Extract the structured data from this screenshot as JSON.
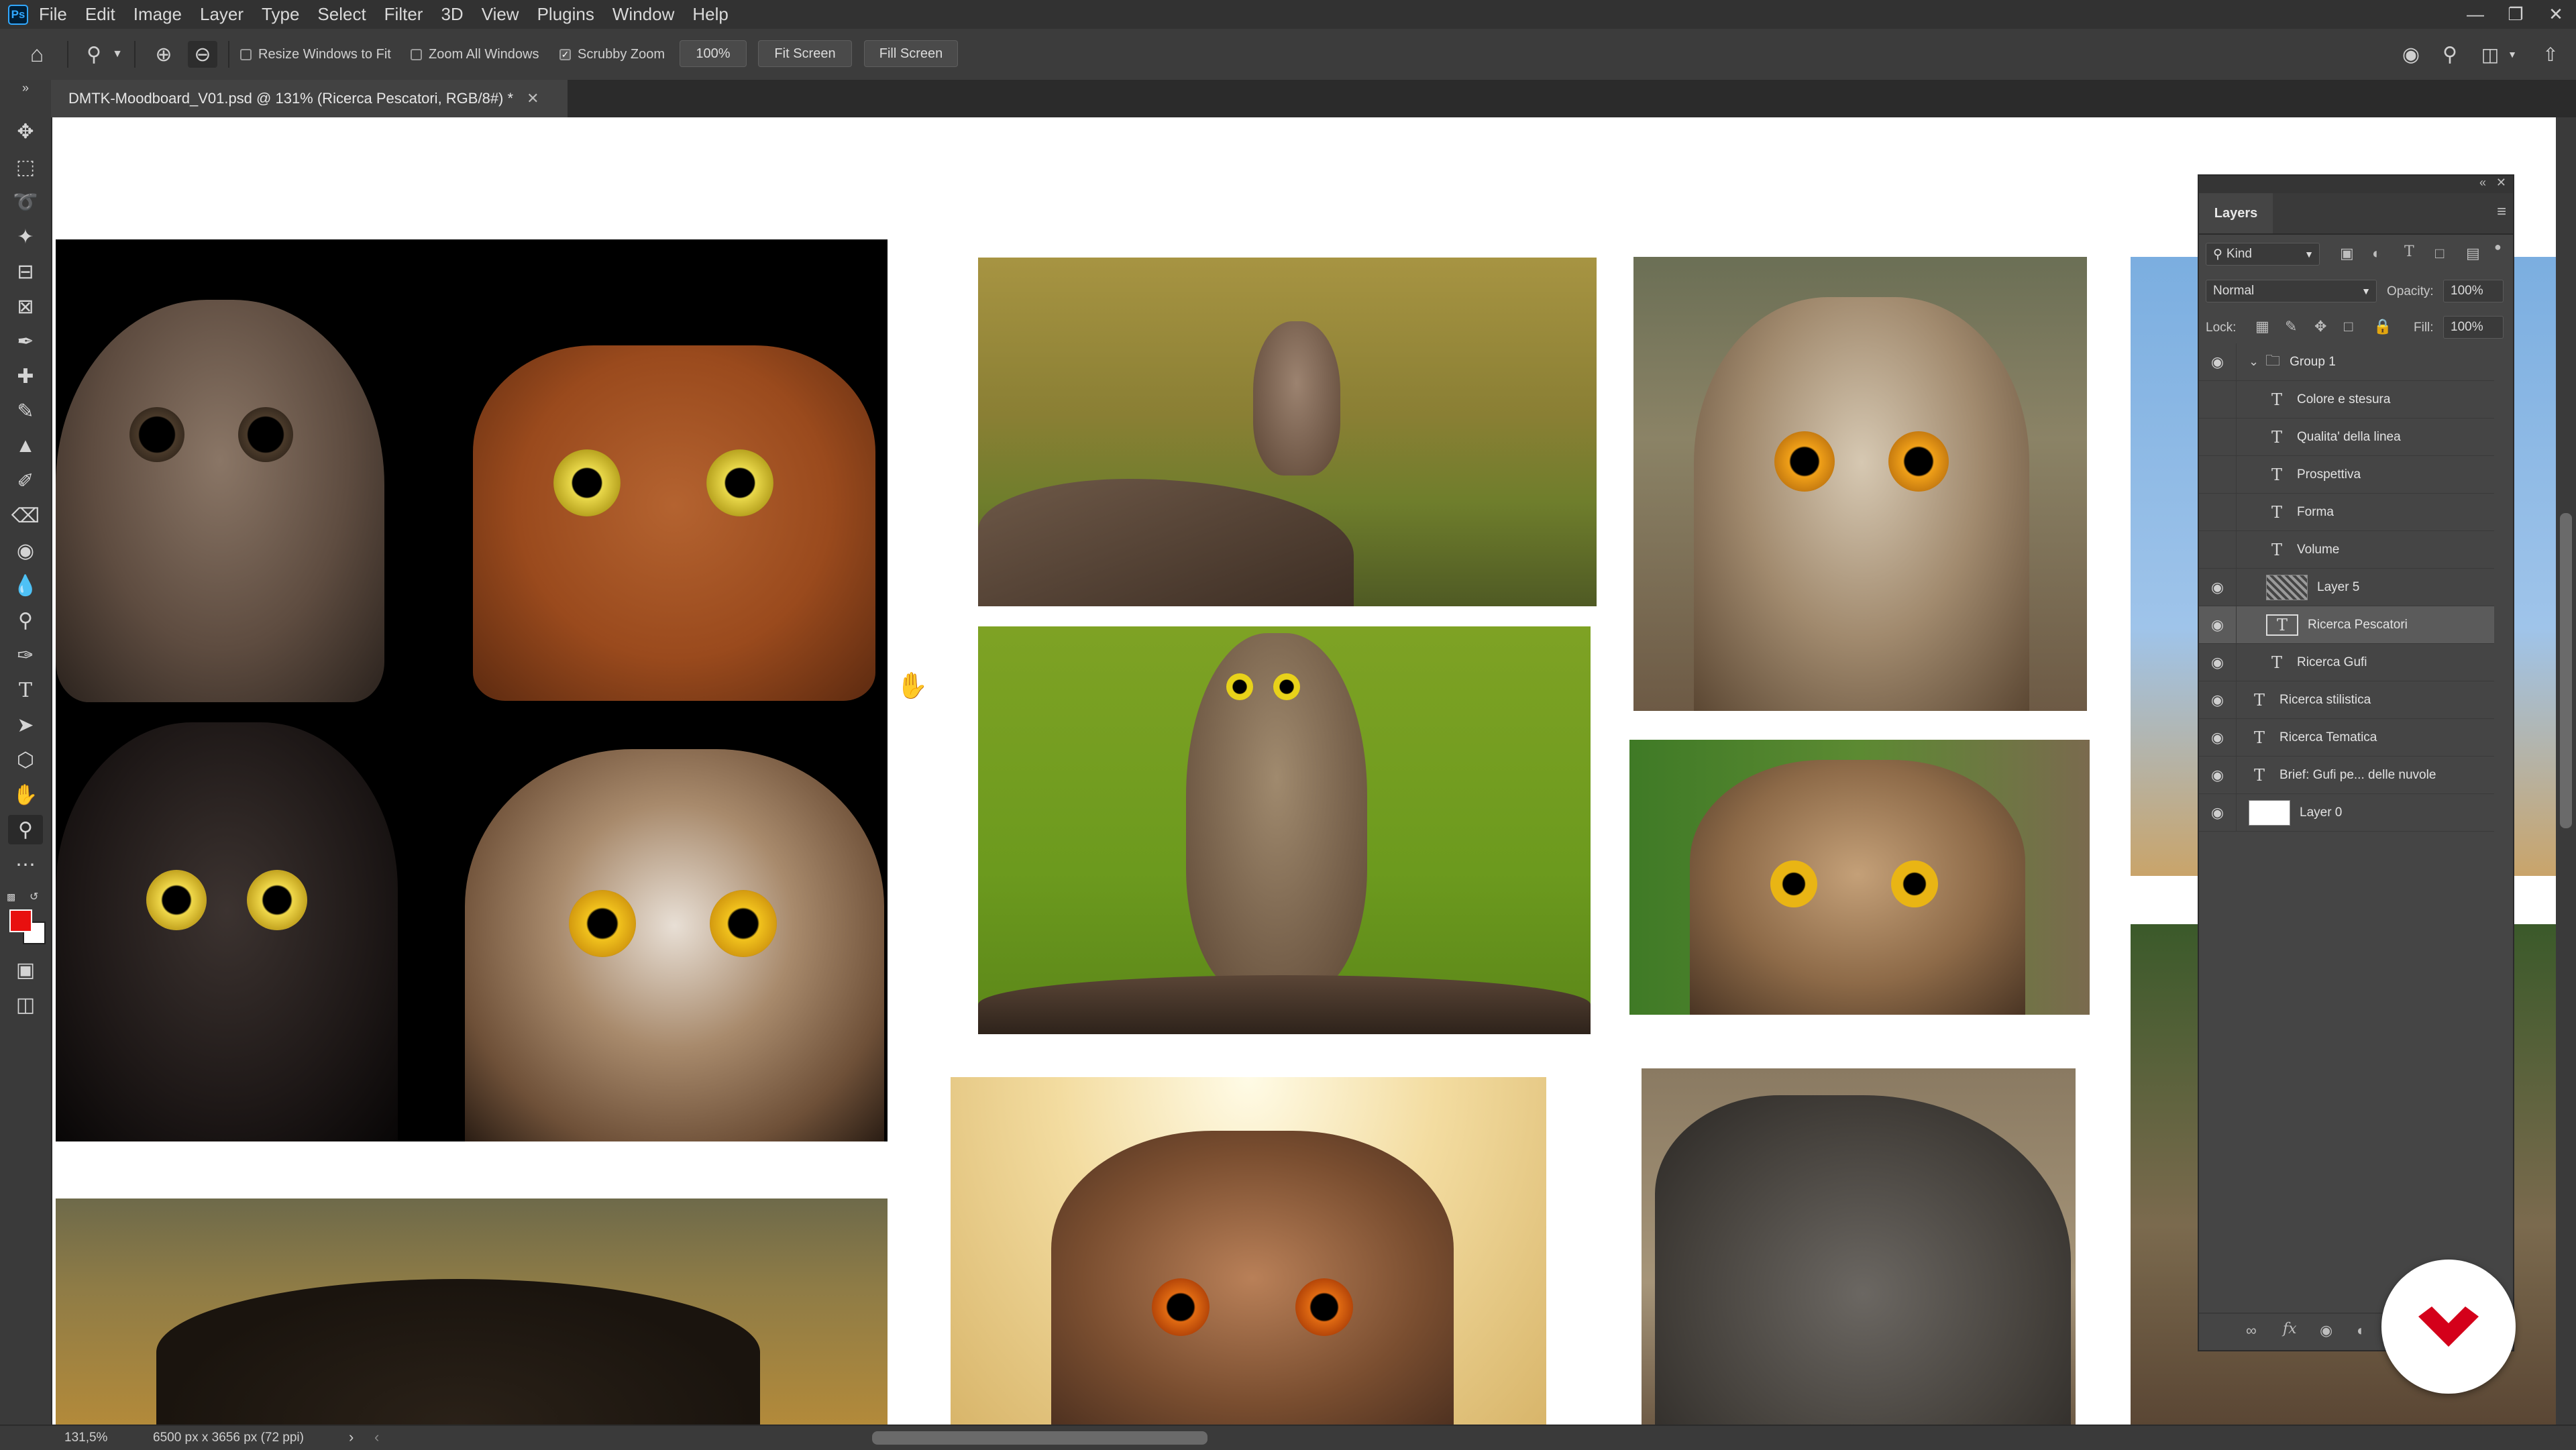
{
  "menubar": {
    "app_logo": "Ps",
    "items": [
      "File",
      "Edit",
      "Image",
      "Layer",
      "Type",
      "Select",
      "Filter",
      "3D",
      "View",
      "Plugins",
      "Window",
      "Help"
    ]
  },
  "options": {
    "resize_windows": "Resize Windows to Fit",
    "resize_windows_checked": false,
    "zoom_all": "Zoom All Windows",
    "zoom_all_checked": false,
    "scrubby": "Scrubby Zoom",
    "scrubby_checked": true,
    "zoom_value": "100%",
    "fit_screen": "Fit Screen",
    "fill_screen": "Fill Screen"
  },
  "document": {
    "tab_title": "DMTK-Moodboard_V01.psd @ 131% (Ricerca Pescatori, RGB/8#) *"
  },
  "layers_panel": {
    "title": "Layers",
    "filter": "Kind",
    "blend_mode": "Normal",
    "opacity_label": "Opacity:",
    "opacity": "100%",
    "lock_label": "Lock:",
    "fill_label": "Fill:",
    "fill": "100%",
    "layers": [
      {
        "name": "Group 1",
        "kind": "group",
        "visible": true,
        "indent": 0
      },
      {
        "name": "Colore e stesura",
        "kind": "text",
        "visible": false,
        "indent": 1
      },
      {
        "name": "Qualita' della linea",
        "kind": "text",
        "visible": false,
        "indent": 1
      },
      {
        "name": "Prospettiva",
        "kind": "text",
        "visible": false,
        "indent": 1
      },
      {
        "name": "Forma",
        "kind": "text",
        "visible": false,
        "indent": 1
      },
      {
        "name": "Volume",
        "kind": "text",
        "visible": false,
        "indent": 1
      },
      {
        "name": "Layer 5",
        "kind": "image",
        "visible": true,
        "indent": 1
      },
      {
        "name": "Ricerca Pescatori",
        "kind": "text",
        "visible": true,
        "indent": 1,
        "selected": true
      },
      {
        "name": "Ricerca Gufi",
        "kind": "text",
        "visible": true,
        "indent": 1
      },
      {
        "name": "Ricerca stilistica",
        "kind": "text",
        "visible": true,
        "indent": 0
      },
      {
        "name": "Ricerca Tematica",
        "kind": "text",
        "visible": true,
        "indent": 0
      },
      {
        "name": "Brief: Gufi pe... delle nuvole",
        "kind": "text",
        "visible": true,
        "indent": 0
      },
      {
        "name": "Layer 0",
        "kind": "fill",
        "visible": true,
        "indent": 0
      }
    ]
  },
  "status": {
    "zoom": "131,5%",
    "doc_size": "6500 px x 3656 px (72 ppi)"
  },
  "colors": {
    "foreground": "#e8100f",
    "background": "#ffffff",
    "badge_accent": "#d4001a"
  }
}
